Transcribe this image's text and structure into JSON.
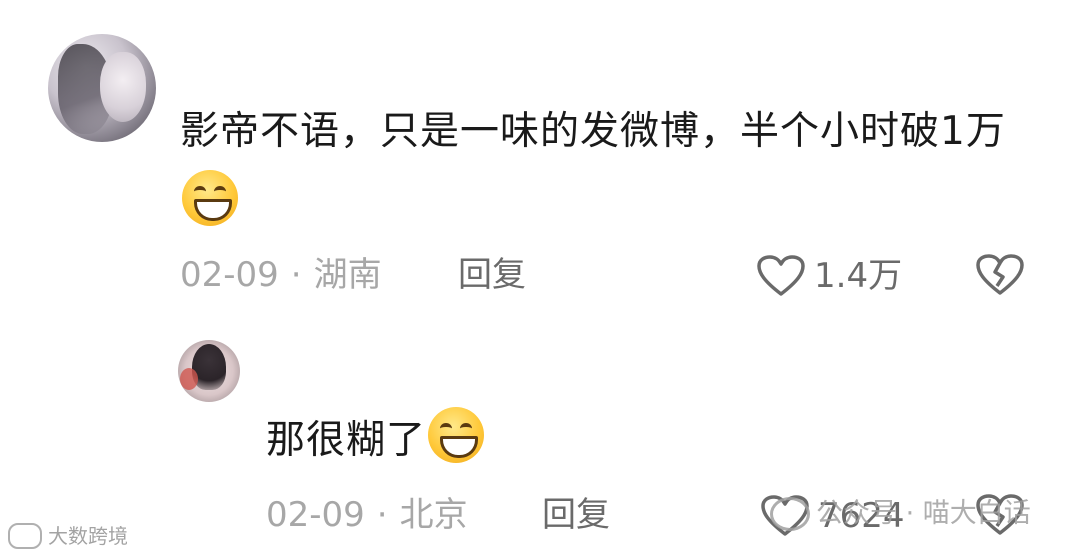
{
  "comments": [
    {
      "text": "影帝不语，只是一味的发微博，半个小时破1万",
      "date": "02-09",
      "separator": "·",
      "location": "湖南",
      "reply_label": "回复",
      "likes": "1.4万",
      "emoji": "grin-emoji"
    },
    {
      "text": "那很糊了",
      "date": "02-09",
      "separator": "·",
      "location": "北京",
      "reply_label": "回复",
      "likes": "7624",
      "emoji": "grin-emoji"
    }
  ],
  "watermarks": {
    "left": "大数跨境",
    "right": "公众号 · 喵大白话"
  },
  "icons": {
    "like": "heart-outline-icon",
    "dislike": "broken-heart-icon"
  },
  "colors": {
    "text": "#1a1a1a",
    "meta": "#a7a7a7",
    "action": "#6a6a6a",
    "background": "#ffffff"
  }
}
